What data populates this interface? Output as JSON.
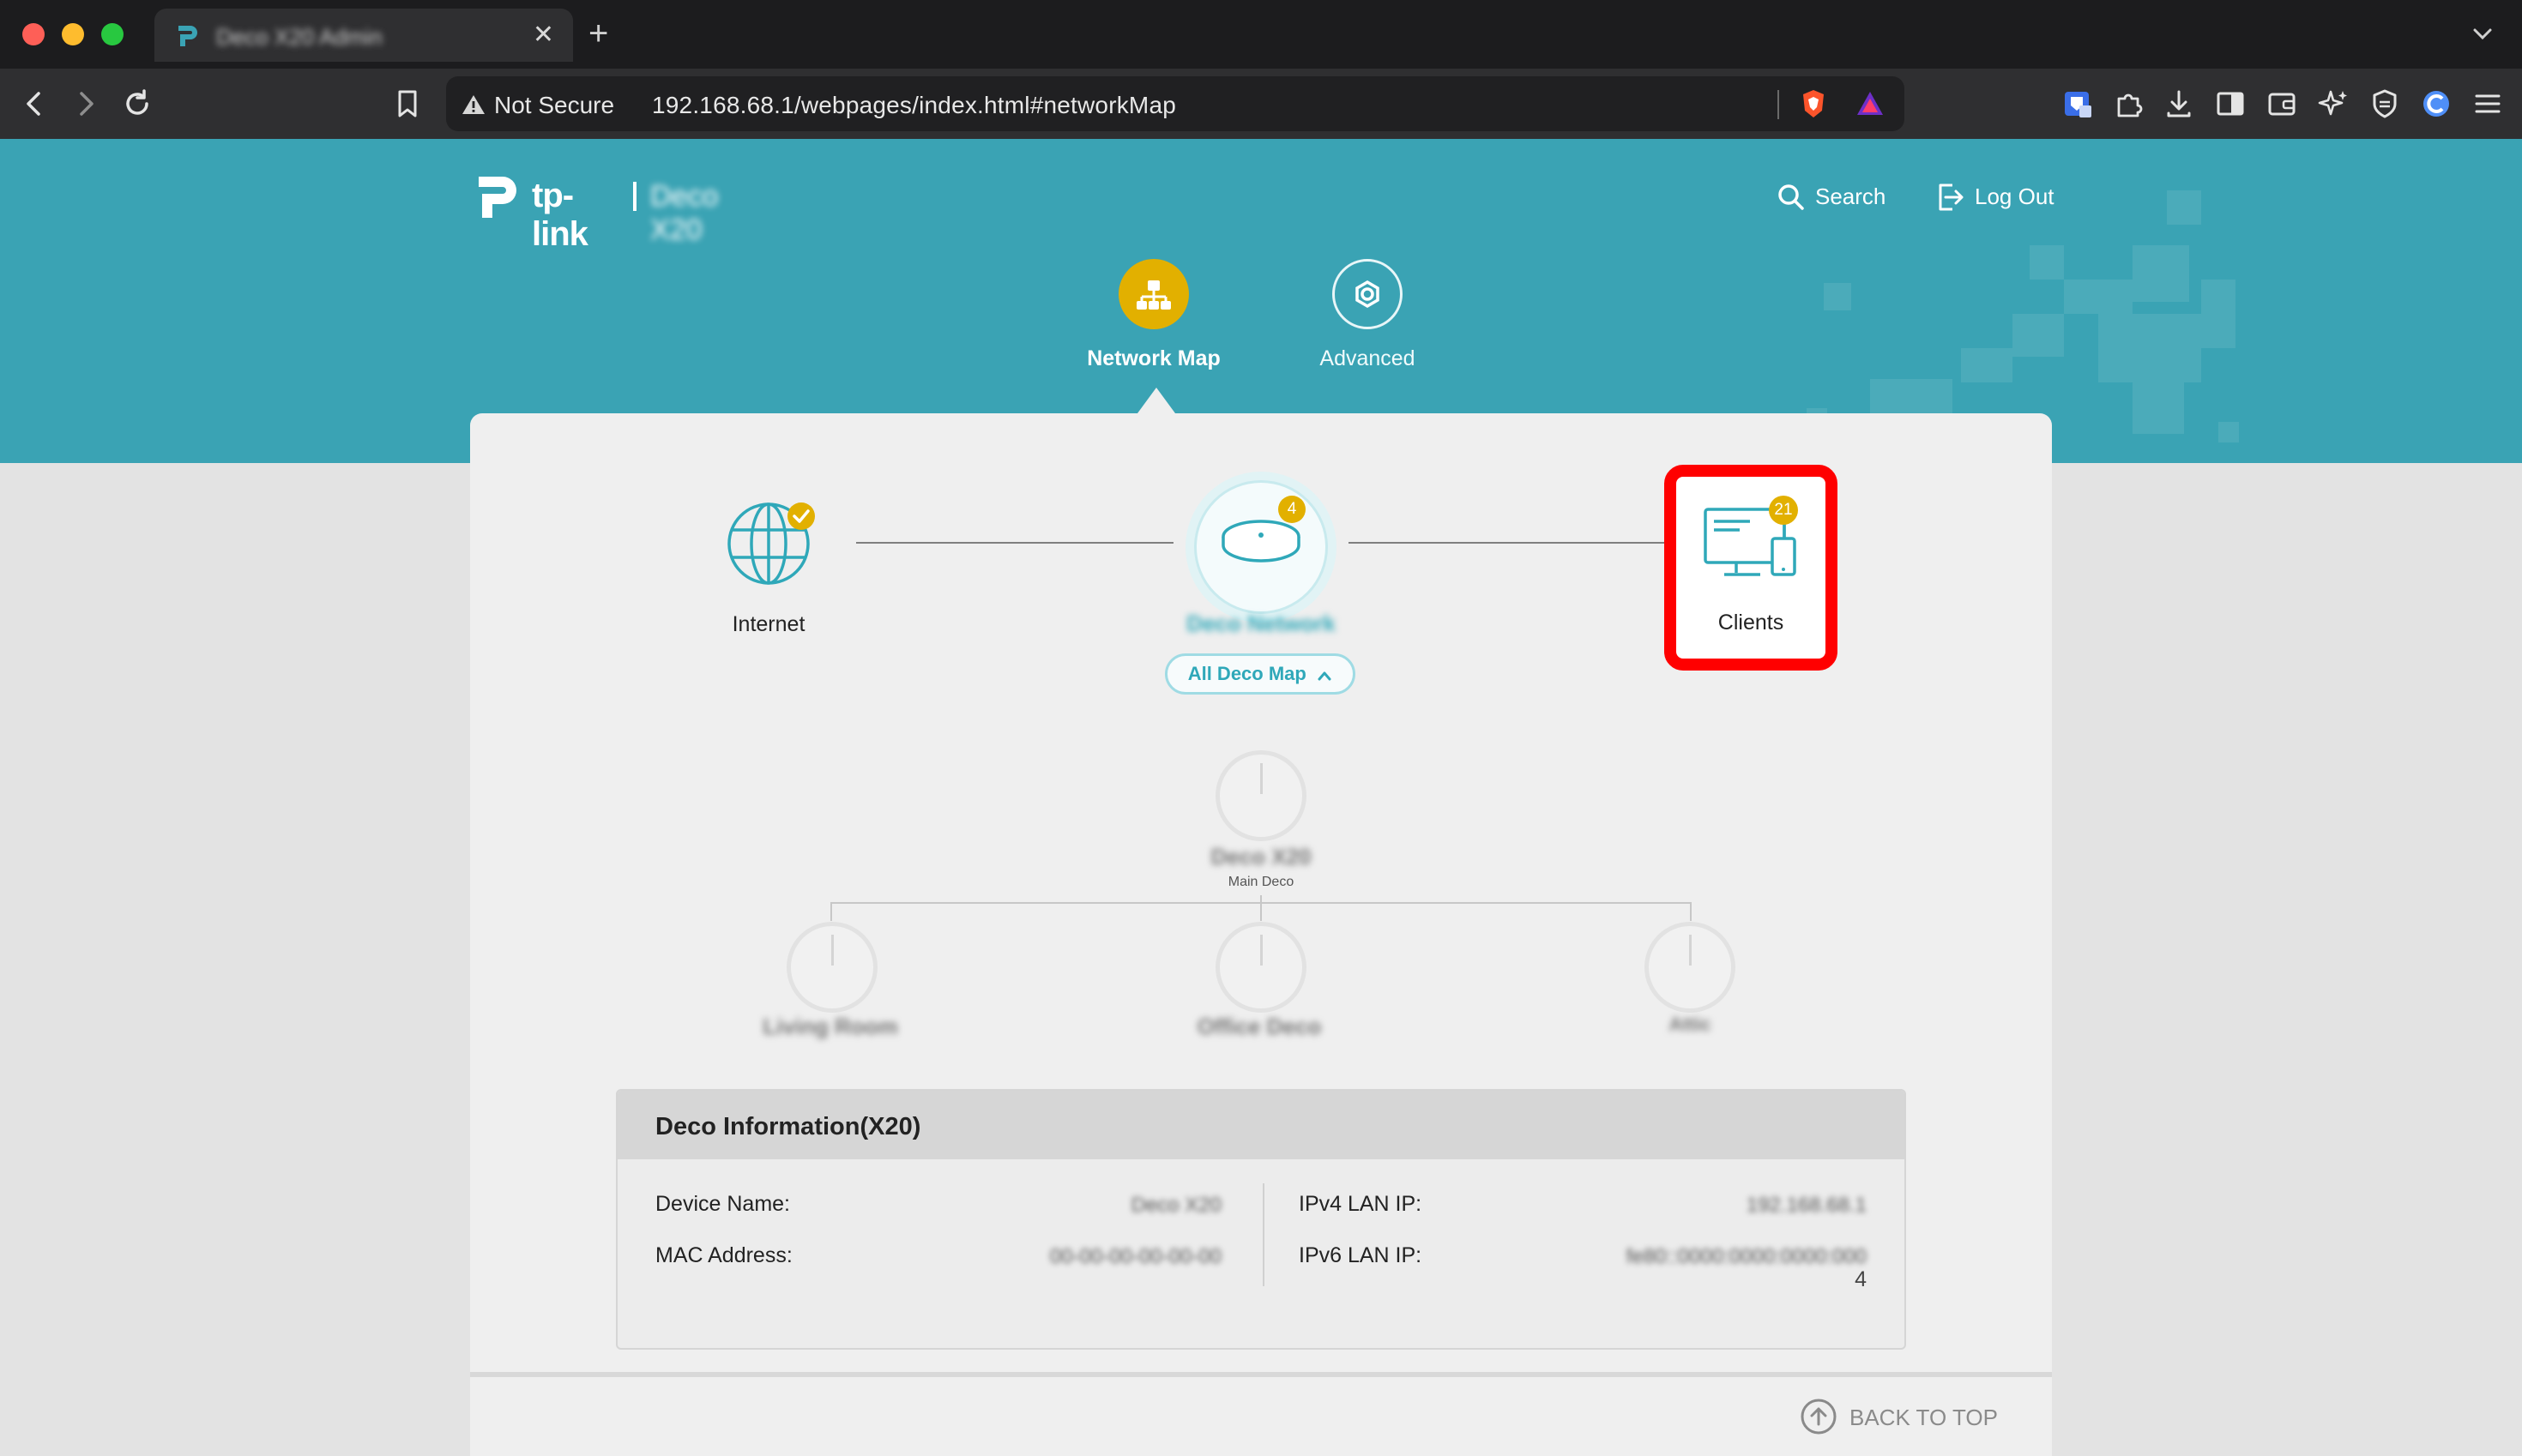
{
  "browser": {
    "tab_title": "Deco X20 Admin",
    "new_tab_label": "+",
    "security_label": "Not Secure",
    "url": "192.168.68.1/webpages/index.html#networkMap"
  },
  "header": {
    "brand": "tp-link",
    "model": "Deco X20",
    "search_label": "Search",
    "logout_label": "Log Out"
  },
  "nav": {
    "tabs": [
      {
        "label": "Network Map",
        "active": true
      },
      {
        "label": "Advanced",
        "active": false
      }
    ]
  },
  "network_map": {
    "internet_label": "Internet",
    "deco_badge": "4",
    "deco_name": "Deco Network",
    "all_deco_label": "All Deco Map",
    "clients_label": "Clients",
    "clients_badge": "21"
  },
  "deco_tree": {
    "main": {
      "name": "Deco X20",
      "role": "Main Deco"
    },
    "satellites": [
      {
        "name": "Living Room"
      },
      {
        "name": "Office Deco"
      },
      {
        "name": "Attic"
      }
    ]
  },
  "deco_info": {
    "title": "Deco Information(X20)",
    "device_name_label": "Device Name:",
    "device_name_value": "Deco X20",
    "mac_label": "MAC Address:",
    "mac_value": "00-00-00-00-00-00",
    "ipv4_label": "IPv4 LAN IP:",
    "ipv4_value": "192.168.68.1",
    "ipv6_label": "IPv6 LAN IP:",
    "ipv6_value": "fe80::0000:0000:0000:000",
    "ipv6_value_tail": "4"
  },
  "footer": {
    "back_to_top_label": "BACK TO TOP"
  },
  "colors": {
    "banner": "#3aa3b4",
    "accent_yellow": "#e2b000",
    "teal": "#2fa8b9",
    "highlight_red": "#ff0000"
  }
}
